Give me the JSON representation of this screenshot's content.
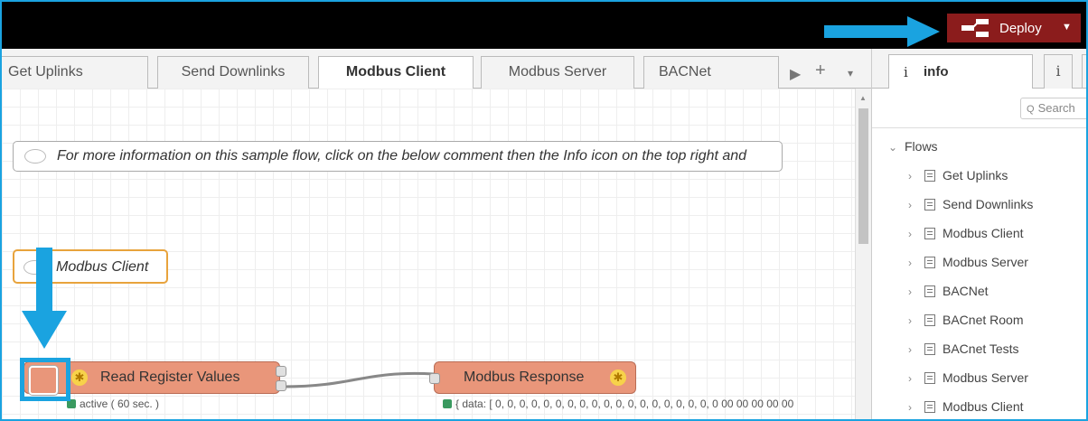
{
  "header": {
    "deploy_label": "Deploy"
  },
  "tabs": [
    {
      "label": "Get Uplinks",
      "active": false
    },
    {
      "label": "Send Downlinks",
      "active": false
    },
    {
      "label": "Modbus Client",
      "active": true
    },
    {
      "label": "Modbus Server",
      "active": false
    },
    {
      "label": "BACNet",
      "active": false
    }
  ],
  "tab_controls": {
    "scroll": "▶",
    "add": "+",
    "menu": "▾"
  },
  "workspace": {
    "info_comment": "For more information on this sample flow, click on the below comment then the Info icon on the top right and",
    "client_comment": "Modbus Client",
    "node_read": {
      "label": "Read Register Values",
      "status": "active ( 60 sec. )"
    },
    "node_response": {
      "label": "Modbus Response",
      "status": "{ data: [ 0, 0, 0, 0, 0, 0, 0, 0, 0, 0, 0, 0, 0, 0, 0, 0, 0, 0, 0 00 00 00 00 00"
    }
  },
  "sidebar": {
    "tab_info_icon": "i",
    "tab_info_label": "info",
    "tab_2_icon": "i",
    "search_placeholder": "Search",
    "search_icon": "Q",
    "flows_label": "Flows",
    "flows": [
      "Get Uplinks",
      "Send Downlinks",
      "Modbus Client",
      "Modbus Server",
      "BACNet",
      "BACnet Room",
      "BACnet Tests",
      "Modbus Server",
      "Modbus Client"
    ]
  },
  "colors": {
    "accent_highlight": "#1aa3e0",
    "deploy_bg": "#8b1c1c",
    "node_fill": "#e9967a",
    "comment_selected": "#e8a33c",
    "status_active": "#3a9a60"
  }
}
